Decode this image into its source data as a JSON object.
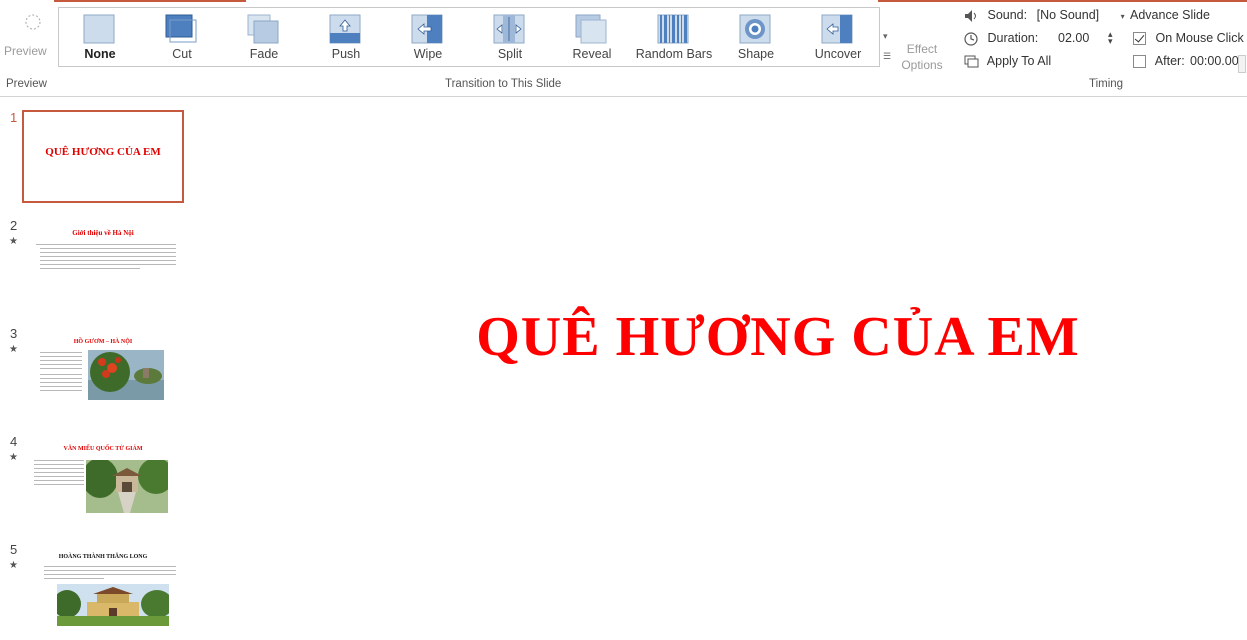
{
  "ribbon": {
    "preview_label": "Preview",
    "transitions": [
      {
        "label": "None",
        "icon": "none-transition-icon",
        "selected": true
      },
      {
        "label": "Cut",
        "icon": "cut-transition-icon"
      },
      {
        "label": "Fade",
        "icon": "fade-transition-icon"
      },
      {
        "label": "Push",
        "icon": "push-transition-icon"
      },
      {
        "label": "Wipe",
        "icon": "wipe-transition-icon"
      },
      {
        "label": "Split",
        "icon": "split-transition-icon"
      },
      {
        "label": "Reveal",
        "icon": "reveal-transition-icon"
      },
      {
        "label": "Random Bars",
        "icon": "random-bars-transition-icon"
      },
      {
        "label": "Shape",
        "icon": "shape-transition-icon"
      },
      {
        "label": "Uncover",
        "icon": "uncover-transition-icon"
      }
    ],
    "effect_options_line1": "Effect",
    "effect_options_line2": "Options",
    "group_labels": {
      "preview": "Preview",
      "transition": "Transition to This Slide",
      "timing": "Timing"
    },
    "timing": {
      "sound_label": "Sound:",
      "sound_value": "[No Sound]",
      "duration_label": "Duration:",
      "duration_value": "02.00",
      "apply_all_label": "Apply To All",
      "advance_title": "Advance Slide",
      "on_mouse_click_label": "On Mouse Click",
      "on_mouse_click_checked": true,
      "after_label": "After:",
      "after_value": "00:00.00",
      "after_checked": false
    },
    "accent_color": "#c55a3e"
  },
  "slides": [
    {
      "number": "1",
      "title": "QUÊ HƯƠNG CỦA EM",
      "active": true,
      "has_animation": false
    },
    {
      "number": "2",
      "title": "Giới thiệu về Hà Nội",
      "active": false,
      "has_animation": true
    },
    {
      "number": "3",
      "title": "HỒ GƯƠM – HÀ NỘI",
      "active": false,
      "has_animation": true
    },
    {
      "number": "4",
      "title": "VĂN MIẾU QUỐC TỬ GIÁM",
      "active": false,
      "has_animation": true
    },
    {
      "number": "5",
      "title": "HOÀNG THÀNH THĂNG LONG",
      "active": false,
      "has_animation": true
    }
  ],
  "main_slide": {
    "title": "QUÊ HƯƠNG CỦA EM",
    "title_color": "#ff0000"
  }
}
